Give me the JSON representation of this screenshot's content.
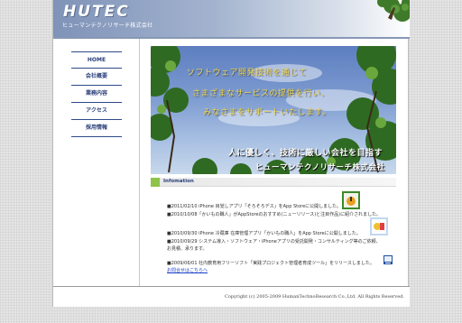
{
  "header": {
    "logo": "HUTEC",
    "company_sub": "ヒューマンテクノリサーチ株式会社"
  },
  "nav": [
    {
      "label": "HOME"
    },
    {
      "label": "会社概要"
    },
    {
      "label": "業務内容"
    },
    {
      "label": "アクセス"
    },
    {
      "label": "採用情報"
    }
  ],
  "hero": {
    "line1": "ソフトウェア開発技術を通じて",
    "line2": "さまざまなサービスの提供を行い、",
    "line3": "みなさまをサポートいたします。",
    "line4": "人に優しく、技術に厳しい会社を目指す",
    "company": "ヒューマンテクノリサーチ株式会社"
  },
  "information": {
    "heading": "Infomation",
    "items": [
      {
        "text": "■2011/02/10 iPhone 目覚しアプリ「そろそろデス」をApp Storeに公開しました。"
      },
      {
        "text": "■2010/10/08「かいもの職人」がAppStoreのおすすめ(ニューリリース)と注目作品)に紹介されました。"
      },
      {
        "text": "■2010/09/30 iPhone 冷蔵庫 在庫管理アプリ「かいもの職人」をApp Storeに公開しました。"
      },
      {
        "text": "■2010/09/29 システム導入・ソフトウェア・iPhoneアプリの受託開発・コンサルティング等のご依頼、お見積、承ります。"
      },
      {
        "text": "■2009/06/01 社内教育用フリーソフト「実践プロジェクト管理者育成ツール」をリリースしました。"
      },
      {
        "link": "お問合せはこちらへ"
      }
    ]
  },
  "footer": {
    "copyright": "Copyright (c) 2005-2009 HumanTechnoResearch Co.,Ltd. All Rights Reserved."
  },
  "colors": {
    "nav_text": "#2a3f7a",
    "hero_gold": "#f2d64a",
    "info_mark": "#8fc34a",
    "link": "#1a3cc7"
  }
}
